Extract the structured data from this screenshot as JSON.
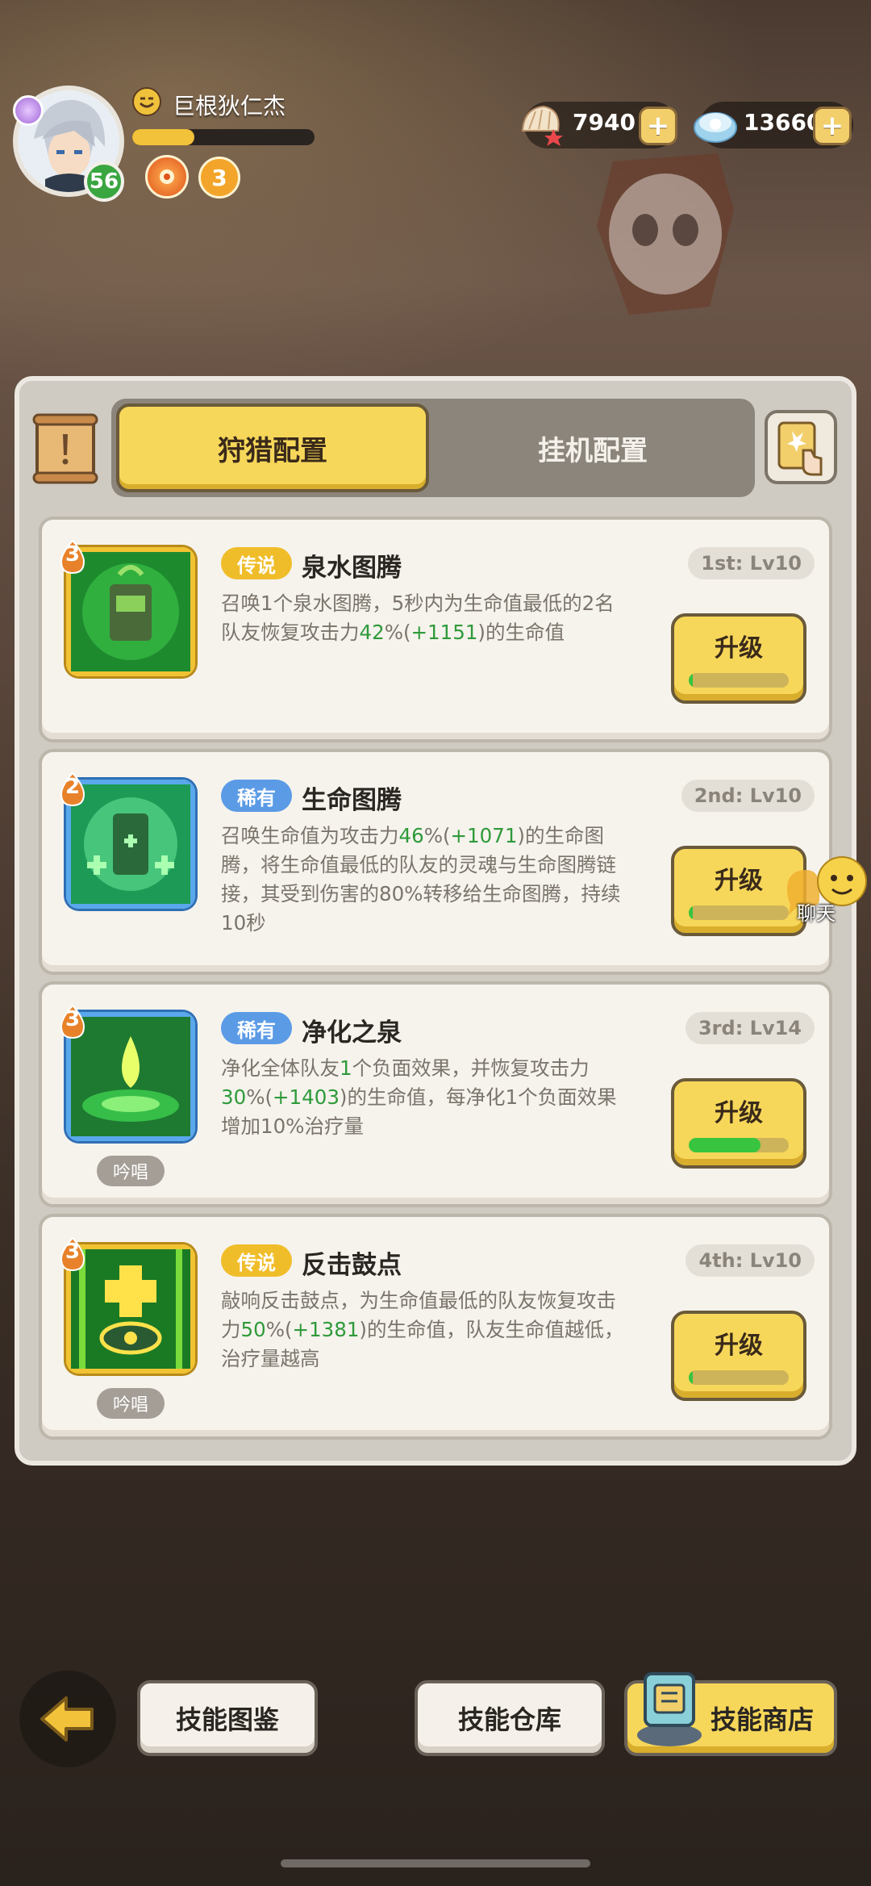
{
  "player": {
    "name": "巨根狄仁杰",
    "level": "56",
    "exp_fraction": 0.34,
    "badge2_glyph": "3"
  },
  "currencies": [
    {
      "icon": "shell-star-icon",
      "value": "7940"
    },
    {
      "icon": "pearl-shell-icon",
      "value": "13660"
    }
  ],
  "tabs": {
    "active": "狩猎配置",
    "inactive": "挂机配置"
  },
  "skills": [
    {
      "stack": "3",
      "rarity": "传说",
      "rarity_type": "legendary",
      "name": "泉水图腾",
      "rank": "1st: Lv10",
      "desc_parts": [
        {
          "t": "召唤1个泉水图腾，5秒内为生命值最低的2名队友恢复攻击力"
        },
        {
          "t": "42",
          "g": true
        },
        {
          "t": "%("
        },
        {
          "t": "+1151",
          "g": true
        },
        {
          "t": ")的生命值"
        }
      ],
      "upgrade_label": "升级",
      "progress": 0.04,
      "chant": null,
      "icon": "fountain-totem-icon"
    },
    {
      "stack": "2",
      "rarity": "稀有",
      "rarity_type": "rare",
      "name": "生命图腾",
      "rank": "2nd: Lv10",
      "desc_parts": [
        {
          "t": "召唤生命值为攻击力"
        },
        {
          "t": "46",
          "g": true
        },
        {
          "t": "%("
        },
        {
          "t": "+1071",
          "g": true
        },
        {
          "t": ")的生命图腾，将生命值最低的队友的灵魂与生命图腾链接，其受到伤害的80%转移给生命图腾，持续10秒"
        }
      ],
      "upgrade_label": "升级",
      "progress": 0.04,
      "chant": null,
      "icon": "life-totem-icon"
    },
    {
      "stack": "3",
      "rarity": "稀有",
      "rarity_type": "rare",
      "name": "净化之泉",
      "rank": "3rd: Lv14",
      "desc_parts": [
        {
          "t": "净化全体队友"
        },
        {
          "t": "1",
          "g": true
        },
        {
          "t": "个负面效果，并恢复攻击力"
        },
        {
          "t": "30",
          "g": true
        },
        {
          "t": "%("
        },
        {
          "t": "+1403",
          "g": true
        },
        {
          "t": ")的生命值，每净化1个负面效果增加10%治疗量"
        }
      ],
      "upgrade_label": "升级",
      "progress": 0.72,
      "chant": "吟唱",
      "icon": "purify-spring-icon"
    },
    {
      "stack": "3",
      "rarity": "传说",
      "rarity_type": "legendary",
      "name": "反击鼓点",
      "rank": "4th: Lv10",
      "desc_parts": [
        {
          "t": "敲响反击鼓点，为生命值最低的队友恢复攻击力"
        },
        {
          "t": "50",
          "g": true
        },
        {
          "t": "%("
        },
        {
          "t": "+1381",
          "g": true
        },
        {
          "t": ")的生命值，队友生命值越低，治疗量越高"
        }
      ],
      "upgrade_label": "升级",
      "progress": 0.04,
      "chant": "吟唱",
      "icon": "counter-drum-icon"
    }
  ],
  "chat": {
    "label": "聊天"
  },
  "bottom": {
    "back_icon": "back-arrow-icon",
    "codex": "技能图鉴",
    "warehouse": "技能仓库",
    "shop": "技能商店"
  },
  "colors": {
    "accent_yellow": "#f7d75a",
    "legendary": "#f0bd2a",
    "rare": "#5b9be6",
    "green_value": "#2f9a3a"
  }
}
